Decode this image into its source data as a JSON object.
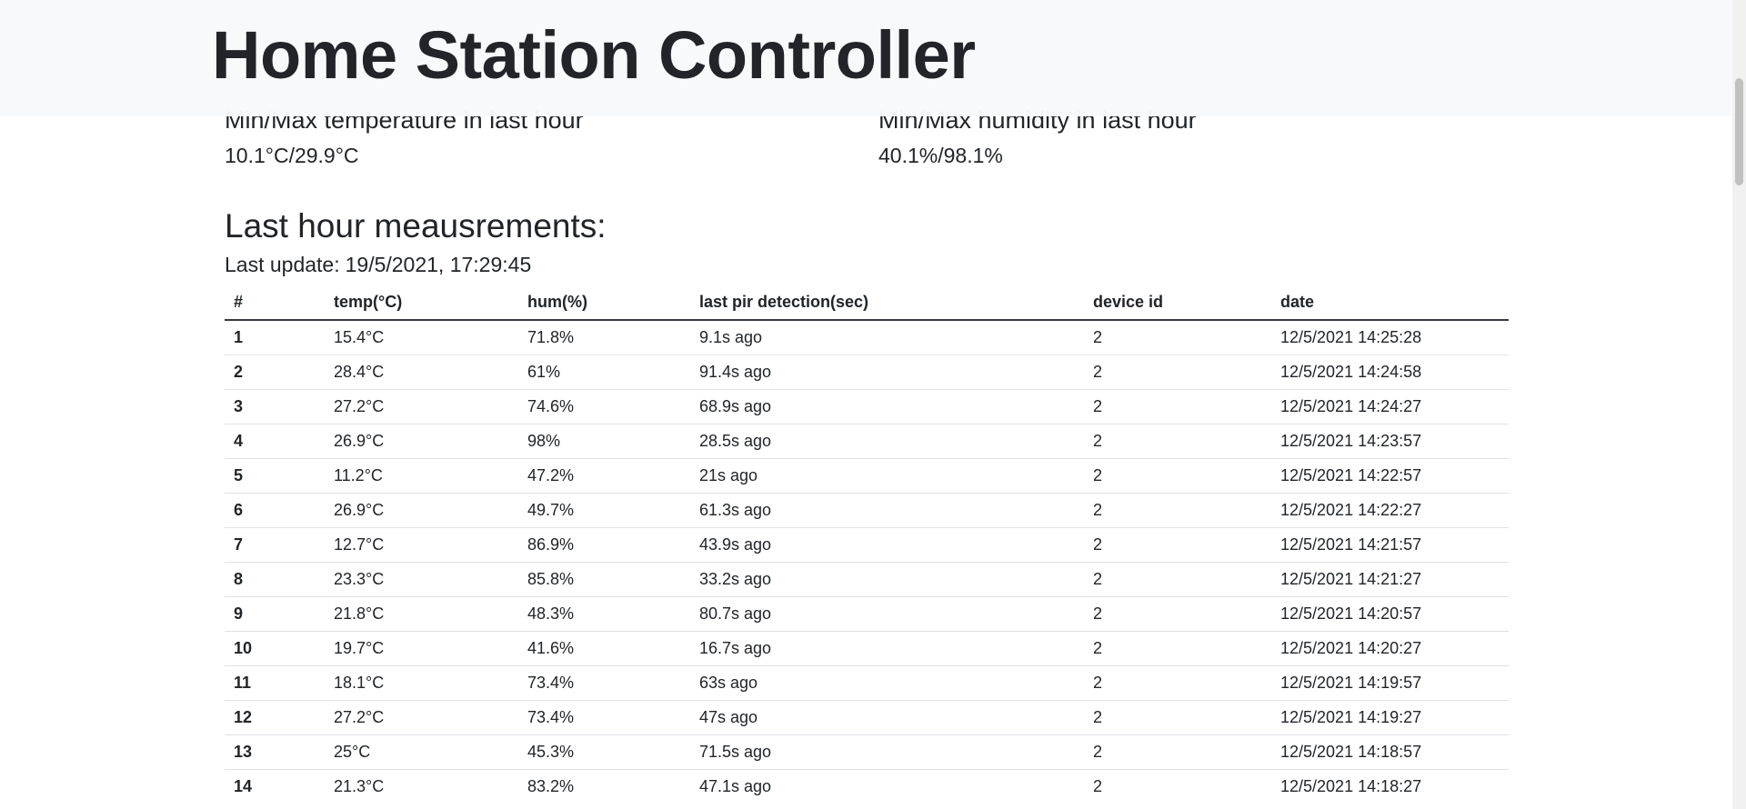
{
  "header": {
    "title": "Home Station Controller"
  },
  "temperature": {
    "title": "Min/Max temperature in last hour",
    "value": "10.1°C/29.9°C"
  },
  "humidity": {
    "title": "Min/Max humidity in last hour",
    "value": "40.1%/98.1%"
  },
  "measurements": {
    "title": "Last hour meausrements:",
    "last_update_label": "Last update:",
    "last_update_value": "19/5/2021, 17:29:45",
    "columns": [
      "#",
      "temp(°C)",
      "hum(%)",
      "last pir detection(sec)",
      "device id",
      "date"
    ],
    "rows": [
      [
        "1",
        "15.4°C",
        "71.8%",
        "9.1s ago",
        "2",
        "12/5/2021 14:25:28"
      ],
      [
        "2",
        "28.4°C",
        "61%",
        "91.4s ago",
        "2",
        "12/5/2021 14:24:58"
      ],
      [
        "3",
        "27.2°C",
        "74.6%",
        "68.9s ago",
        "2",
        "12/5/2021 14:24:27"
      ],
      [
        "4",
        "26.9°C",
        "98%",
        "28.5s ago",
        "2",
        "12/5/2021 14:23:57"
      ],
      [
        "5",
        "11.2°C",
        "47.2%",
        "21s ago",
        "2",
        "12/5/2021 14:22:57"
      ],
      [
        "6",
        "26.9°C",
        "49.7%",
        "61.3s ago",
        "2",
        "12/5/2021 14:22:27"
      ],
      [
        "7",
        "12.7°C",
        "86.9%",
        "43.9s ago",
        "2",
        "12/5/2021 14:21:57"
      ],
      [
        "8",
        "23.3°C",
        "85.8%",
        "33.2s ago",
        "2",
        "12/5/2021 14:21:27"
      ],
      [
        "9",
        "21.8°C",
        "48.3%",
        "80.7s ago",
        "2",
        "12/5/2021 14:20:57"
      ],
      [
        "10",
        "19.7°C",
        "41.6%",
        "16.7s ago",
        "2",
        "12/5/2021 14:20:27"
      ],
      [
        "11",
        "18.1°C",
        "73.4%",
        "63s ago",
        "2",
        "12/5/2021 14:19:57"
      ],
      [
        "12",
        "27.2°C",
        "73.4%",
        "47s ago",
        "2",
        "12/5/2021 14:19:27"
      ],
      [
        "13",
        "25°C",
        "45.3%",
        "71.5s ago",
        "2",
        "12/5/2021 14:18:57"
      ],
      [
        "14",
        "21.3°C",
        "83.2%",
        "47.1s ago",
        "2",
        "12/5/2021 14:18:27"
      ]
    ]
  },
  "colors": {
    "header_bg": "#f8f9fa",
    "text": "#212529",
    "row_border": "#dee2e6",
    "header_border": "#343a40"
  }
}
